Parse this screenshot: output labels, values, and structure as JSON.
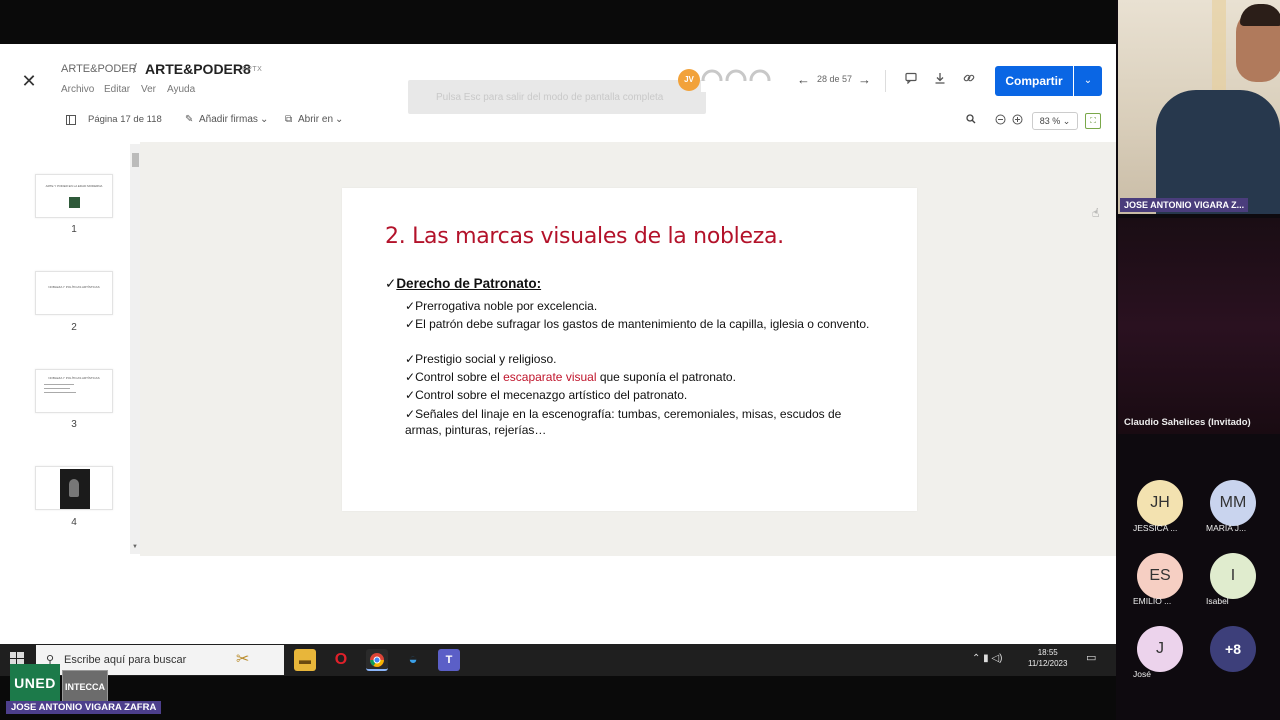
{
  "header": {
    "breadcrumb_parent": "ARTE&PODER",
    "breadcrumb_sep": "/",
    "title": "ARTE&PODER8",
    "ext": "PPTX",
    "menus": [
      "Archivo",
      "Editar",
      "Ver",
      "Ayuda"
    ],
    "overlay_tip": "Pulsa  Esc  para salir del modo de pantalla completa",
    "avatar_initials": "JV",
    "slide_counter": "28 de 57",
    "share_label": "Compartir"
  },
  "toolbar": {
    "page_indicator": "Página 17 de 118",
    "add_signatures": "Añadir firmas",
    "open_in": "Abrir en",
    "zoom": "83 %"
  },
  "thumbnails": [
    {
      "num": "1",
      "text": "ARTE Y PODER EN LA EDAD MODERNA"
    },
    {
      "num": "2",
      "text": "NOBLEZA Y POLÍTICAS ARTÍSTICAS"
    },
    {
      "num": "3",
      "text": "NOBLEZA Y POLÍTICAS ARTÍSTICAS"
    },
    {
      "num": "4",
      "text": ""
    }
  ],
  "slide": {
    "title": "2. Las marcas visuales de la nobleza.",
    "heading_check": "✓",
    "heading": "Derecho de Patronato:",
    "bullets": [
      "Prerrogativa noble por excelencia.",
      "El patrón debe sufragar los gastos de mantenimiento de la capilla, iglesia o convento.",
      "Prestigio social y religioso.",
      "Control sobre el mecenazgo artístico del patronato.",
      "Señales del linaje en la escenografía: tumbas, ceremoniales, misas, escudos de armas, pinturas, rejerías…"
    ],
    "bullet4_pre": "Control sobre el ",
    "bullet4_hl": "escaparate visual",
    "bullet4_post": " que suponía el patronato."
  },
  "taskbar": {
    "search_placeholder": "Escribe aquí para buscar",
    "time": "18:55",
    "date": "11/12/2023"
  },
  "overlays": {
    "uned": "UNED",
    "intecca": "INTECCA",
    "presenter_name": "JOSE ANTONIO VIGARA ZAFRA"
  },
  "participants": {
    "speaker_label": "JOSE ANTONIO VIGARA Z...",
    "claudio_label": "Claudio Sahelices (Invitado)",
    "list": [
      {
        "initials": "JH",
        "name": "JESSICA ...",
        "color": "#f3e2b0"
      },
      {
        "initials": "MM",
        "name": "MARIA J...",
        "color": "#c9d4ee"
      },
      {
        "initials": "ES",
        "name": "EMILIO ...",
        "color": "#f6cfc3"
      },
      {
        "initials": "I",
        "name": "Isabel",
        "color": "#e0ecce"
      },
      {
        "initials": "J",
        "name": "José",
        "color": "#ecd3ec"
      },
      {
        "initials": "+8",
        "name": "",
        "color": "#3d3f7a"
      }
    ]
  },
  "colors": {
    "share_blue": "#0a66e4",
    "slide_title_red": "#b3122a",
    "name_tag_purple": "#4a3d7c"
  }
}
